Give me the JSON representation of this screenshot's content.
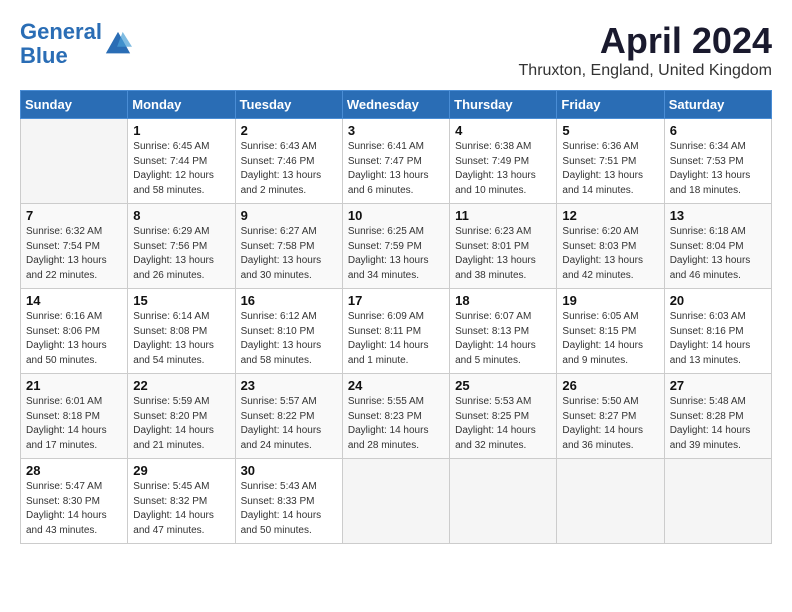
{
  "logo": {
    "line1": "General",
    "line2": "Blue"
  },
  "title": "April 2024",
  "subtitle": "Thruxton, England, United Kingdom",
  "headers": [
    "Sunday",
    "Monday",
    "Tuesday",
    "Wednesday",
    "Thursday",
    "Friday",
    "Saturday"
  ],
  "weeks": [
    [
      {
        "day": "",
        "sunrise": "",
        "sunset": "",
        "daylight": ""
      },
      {
        "day": "1",
        "sunrise": "Sunrise: 6:45 AM",
        "sunset": "Sunset: 7:44 PM",
        "daylight": "Daylight: 12 hours and 58 minutes."
      },
      {
        "day": "2",
        "sunrise": "Sunrise: 6:43 AM",
        "sunset": "Sunset: 7:46 PM",
        "daylight": "Daylight: 13 hours and 2 minutes."
      },
      {
        "day": "3",
        "sunrise": "Sunrise: 6:41 AM",
        "sunset": "Sunset: 7:47 PM",
        "daylight": "Daylight: 13 hours and 6 minutes."
      },
      {
        "day": "4",
        "sunrise": "Sunrise: 6:38 AM",
        "sunset": "Sunset: 7:49 PM",
        "daylight": "Daylight: 13 hours and 10 minutes."
      },
      {
        "day": "5",
        "sunrise": "Sunrise: 6:36 AM",
        "sunset": "Sunset: 7:51 PM",
        "daylight": "Daylight: 13 hours and 14 minutes."
      },
      {
        "day": "6",
        "sunrise": "Sunrise: 6:34 AM",
        "sunset": "Sunset: 7:53 PM",
        "daylight": "Daylight: 13 hours and 18 minutes."
      }
    ],
    [
      {
        "day": "7",
        "sunrise": "Sunrise: 6:32 AM",
        "sunset": "Sunset: 7:54 PM",
        "daylight": "Daylight: 13 hours and 22 minutes."
      },
      {
        "day": "8",
        "sunrise": "Sunrise: 6:29 AM",
        "sunset": "Sunset: 7:56 PM",
        "daylight": "Daylight: 13 hours and 26 minutes."
      },
      {
        "day": "9",
        "sunrise": "Sunrise: 6:27 AM",
        "sunset": "Sunset: 7:58 PM",
        "daylight": "Daylight: 13 hours and 30 minutes."
      },
      {
        "day": "10",
        "sunrise": "Sunrise: 6:25 AM",
        "sunset": "Sunset: 7:59 PM",
        "daylight": "Daylight: 13 hours and 34 minutes."
      },
      {
        "day": "11",
        "sunrise": "Sunrise: 6:23 AM",
        "sunset": "Sunset: 8:01 PM",
        "daylight": "Daylight: 13 hours and 38 minutes."
      },
      {
        "day": "12",
        "sunrise": "Sunrise: 6:20 AM",
        "sunset": "Sunset: 8:03 PM",
        "daylight": "Daylight: 13 hours and 42 minutes."
      },
      {
        "day": "13",
        "sunrise": "Sunrise: 6:18 AM",
        "sunset": "Sunset: 8:04 PM",
        "daylight": "Daylight: 13 hours and 46 minutes."
      }
    ],
    [
      {
        "day": "14",
        "sunrise": "Sunrise: 6:16 AM",
        "sunset": "Sunset: 8:06 PM",
        "daylight": "Daylight: 13 hours and 50 minutes."
      },
      {
        "day": "15",
        "sunrise": "Sunrise: 6:14 AM",
        "sunset": "Sunset: 8:08 PM",
        "daylight": "Daylight: 13 hours and 54 minutes."
      },
      {
        "day": "16",
        "sunrise": "Sunrise: 6:12 AM",
        "sunset": "Sunset: 8:10 PM",
        "daylight": "Daylight: 13 hours and 58 minutes."
      },
      {
        "day": "17",
        "sunrise": "Sunrise: 6:09 AM",
        "sunset": "Sunset: 8:11 PM",
        "daylight": "Daylight: 14 hours and 1 minute."
      },
      {
        "day": "18",
        "sunrise": "Sunrise: 6:07 AM",
        "sunset": "Sunset: 8:13 PM",
        "daylight": "Daylight: 14 hours and 5 minutes."
      },
      {
        "day": "19",
        "sunrise": "Sunrise: 6:05 AM",
        "sunset": "Sunset: 8:15 PM",
        "daylight": "Daylight: 14 hours and 9 minutes."
      },
      {
        "day": "20",
        "sunrise": "Sunrise: 6:03 AM",
        "sunset": "Sunset: 8:16 PM",
        "daylight": "Daylight: 14 hours and 13 minutes."
      }
    ],
    [
      {
        "day": "21",
        "sunrise": "Sunrise: 6:01 AM",
        "sunset": "Sunset: 8:18 PM",
        "daylight": "Daylight: 14 hours and 17 minutes."
      },
      {
        "day": "22",
        "sunrise": "Sunrise: 5:59 AM",
        "sunset": "Sunset: 8:20 PM",
        "daylight": "Daylight: 14 hours and 21 minutes."
      },
      {
        "day": "23",
        "sunrise": "Sunrise: 5:57 AM",
        "sunset": "Sunset: 8:22 PM",
        "daylight": "Daylight: 14 hours and 24 minutes."
      },
      {
        "day": "24",
        "sunrise": "Sunrise: 5:55 AM",
        "sunset": "Sunset: 8:23 PM",
        "daylight": "Daylight: 14 hours and 28 minutes."
      },
      {
        "day": "25",
        "sunrise": "Sunrise: 5:53 AM",
        "sunset": "Sunset: 8:25 PM",
        "daylight": "Daylight: 14 hours and 32 minutes."
      },
      {
        "day": "26",
        "sunrise": "Sunrise: 5:50 AM",
        "sunset": "Sunset: 8:27 PM",
        "daylight": "Daylight: 14 hours and 36 minutes."
      },
      {
        "day": "27",
        "sunrise": "Sunrise: 5:48 AM",
        "sunset": "Sunset: 8:28 PM",
        "daylight": "Daylight: 14 hours and 39 minutes."
      }
    ],
    [
      {
        "day": "28",
        "sunrise": "Sunrise: 5:47 AM",
        "sunset": "Sunset: 8:30 PM",
        "daylight": "Daylight: 14 hours and 43 minutes."
      },
      {
        "day": "29",
        "sunrise": "Sunrise: 5:45 AM",
        "sunset": "Sunset: 8:32 PM",
        "daylight": "Daylight: 14 hours and 47 minutes."
      },
      {
        "day": "30",
        "sunrise": "Sunrise: 5:43 AM",
        "sunset": "Sunset: 8:33 PM",
        "daylight": "Daylight: 14 hours and 50 minutes."
      },
      {
        "day": "",
        "sunrise": "",
        "sunset": "",
        "daylight": ""
      },
      {
        "day": "",
        "sunrise": "",
        "sunset": "",
        "daylight": ""
      },
      {
        "day": "",
        "sunrise": "",
        "sunset": "",
        "daylight": ""
      },
      {
        "day": "",
        "sunrise": "",
        "sunset": "",
        "daylight": ""
      }
    ]
  ]
}
